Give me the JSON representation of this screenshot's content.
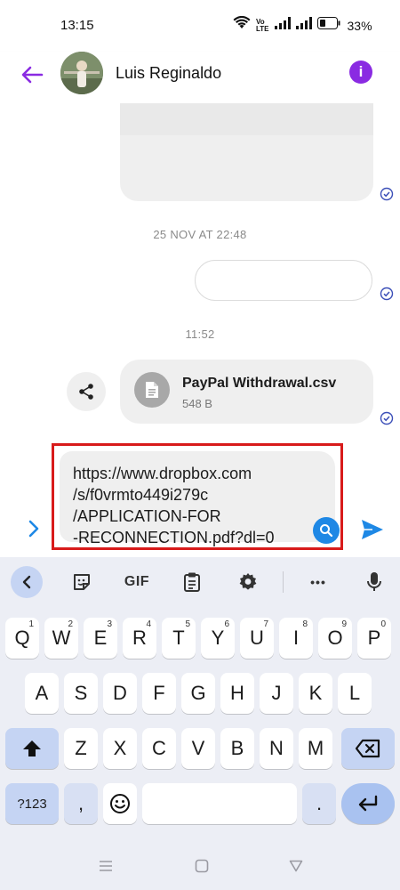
{
  "status_bar": {
    "time": "13:15",
    "battery": "33%",
    "icons": [
      "wifi-icon",
      "volte-icon",
      "signal-icon",
      "signal-icon",
      "battery-icon"
    ]
  },
  "header": {
    "contact_name": "Luis Reginaldo",
    "back_icon": "arrow-left-icon",
    "info_icon": "info-icon",
    "accent_color": "#8a2be2"
  },
  "chat": {
    "timestamps": [
      "25 NOV AT 22:48",
      "11:52"
    ],
    "file_message": {
      "name": "PayPal Withdrawal.csv",
      "size": "548 B"
    },
    "read_receipt_color": "#3b4fb8"
  },
  "composer": {
    "text": "https://www.dropbox.com/s/f0vrmto449i279c/APPLICATION-FOR-RECONNECTION.pdf?dl=0",
    "lines": [
      "https://www.dropbox.com",
      "/s/f0vrmto449i279c",
      "/APPLICATION-FOR",
      "-RECONNECTION.pdf?dl=0"
    ],
    "highlight_color": "#d81b1b",
    "send_color": "#1e88e5"
  },
  "keyboard": {
    "toolbar": {
      "gif_label": "GIF",
      "more_label": "•••"
    },
    "row1": [
      {
        "k": "Q",
        "n": "1"
      },
      {
        "k": "W",
        "n": "2"
      },
      {
        "k": "E",
        "n": "3"
      },
      {
        "k": "R",
        "n": "4"
      },
      {
        "k": "T",
        "n": "5"
      },
      {
        "k": "Y",
        "n": "6"
      },
      {
        "k": "U",
        "n": "7"
      },
      {
        "k": "I",
        "n": "8"
      },
      {
        "k": "O",
        "n": "9"
      },
      {
        "k": "P",
        "n": "0"
      }
    ],
    "row2": [
      "A",
      "S",
      "D",
      "F",
      "G",
      "H",
      "J",
      "K",
      "L"
    ],
    "row3": [
      "Z",
      "X",
      "C",
      "V",
      "B",
      "N",
      "M"
    ],
    "row4": {
      "symbols": "?123",
      "comma": ",",
      "period": "."
    }
  }
}
